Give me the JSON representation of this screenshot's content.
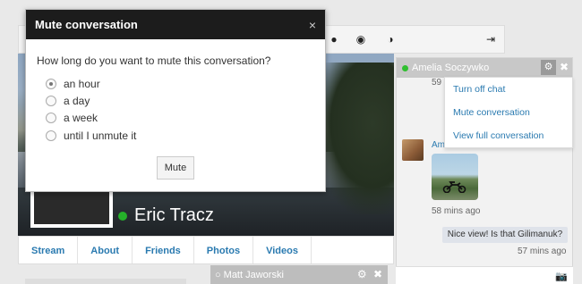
{
  "modal": {
    "title": "Mute conversation",
    "close_glyph": "×",
    "question": "How long do you want to mute this conversation?",
    "options": [
      {
        "label": "an hour",
        "checked": true
      },
      {
        "label": "a day",
        "checked": false
      },
      {
        "label": "a week",
        "checked": false
      },
      {
        "label": "until I unmute it",
        "checked": false
      }
    ],
    "mute_label": "Mute"
  },
  "profile": {
    "name": "Eric Tracz",
    "tabs": [
      "Stream",
      "About",
      "Friends",
      "Photos",
      "Videos"
    ]
  },
  "toolbar": {
    "icons": [
      "user-icon",
      "globe-icon",
      "user-settings-icon",
      "logout-icon"
    ]
  },
  "chat": {
    "contact": "Amelia Soczywko",
    "header_ts": "59",
    "sender_initial": "Am",
    "menu": [
      "Turn off chat",
      "Mute conversation",
      "View full conversation"
    ],
    "photo_time": "58 mins ago",
    "message": "Nice view! Is that Gilimanuk?",
    "message_time": "57 mins ago"
  },
  "chat2": {
    "contact": "Matt Jaworski"
  },
  "colors": {
    "accent": "#2a7ab0",
    "online": "#25b12a",
    "modal_header": "#1c1c1c"
  }
}
